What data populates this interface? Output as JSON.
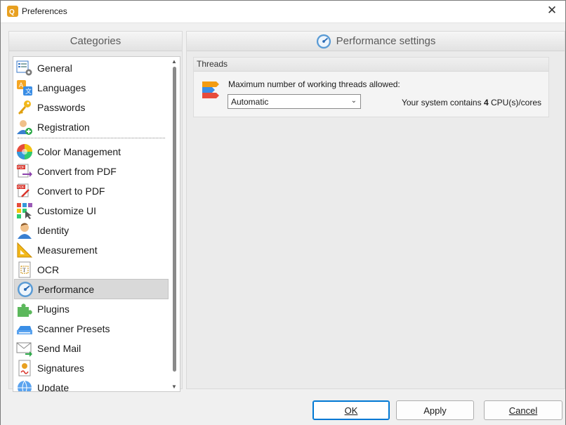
{
  "window": {
    "title": "Preferences"
  },
  "categories": {
    "header": "Categories",
    "items": [
      {
        "label": "General",
        "icon": "general-settings-icon"
      },
      {
        "label": "Languages",
        "icon": "languages-icon"
      },
      {
        "label": "Passwords",
        "icon": "key-icon"
      },
      {
        "label": "Registration",
        "icon": "registration-user-icon"
      },
      {
        "label": "Color Management",
        "icon": "color-wheel-icon"
      },
      {
        "label": "Convert from PDF",
        "icon": "convert-from-pdf-icon"
      },
      {
        "label": "Convert to PDF",
        "icon": "convert-to-pdf-icon"
      },
      {
        "label": "Customize UI",
        "icon": "customize-ui-icon"
      },
      {
        "label": "Identity",
        "icon": "identity-user-icon"
      },
      {
        "label": "Measurement",
        "icon": "ruler-triangle-icon"
      },
      {
        "label": "OCR",
        "icon": "ocr-document-icon"
      },
      {
        "label": "Performance",
        "icon": "gauge-icon"
      },
      {
        "label": "Plugins",
        "icon": "puzzle-piece-icon"
      },
      {
        "label": "Scanner Presets",
        "icon": "scanner-icon"
      },
      {
        "label": "Send Mail",
        "icon": "envelope-icon"
      },
      {
        "label": "Signatures",
        "icon": "signature-document-icon"
      },
      {
        "label": "Update",
        "icon": "globe-update-icon"
      }
    ],
    "selected": "Performance"
  },
  "settings": {
    "header": "Performance settings",
    "group_title": "Threads",
    "threads_label": "Maximum number of working threads allowed:",
    "threads_value": "Automatic",
    "cpu_prefix": "Your system contains",
    "cpu_count": "4",
    "cpu_suffix": "CPU(s)/cores"
  },
  "buttons": {
    "ok": "OK",
    "apply": "Apply",
    "cancel": "Cancel"
  },
  "colors": {
    "accent": "#0078d4",
    "selection": "#d9d9d9"
  }
}
